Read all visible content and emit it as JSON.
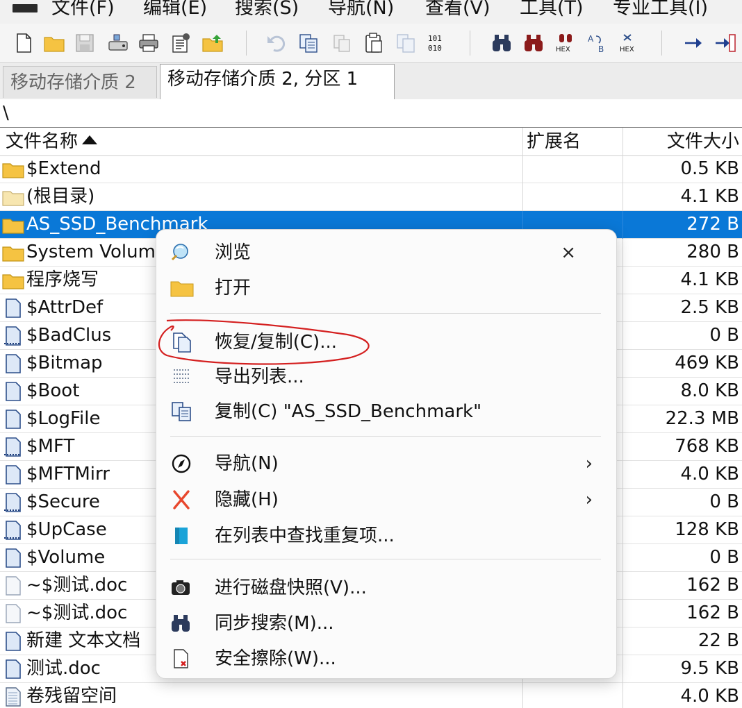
{
  "menubar": {
    "items": [
      "文件(F)",
      "编辑(E)",
      "搜索(S)",
      "导航(N)",
      "查看(V)",
      "工具(T)",
      "专业工具(I)"
    ]
  },
  "toolbar": {
    "icons": [
      "new-file-icon",
      "open-folder-icon",
      "save-icon",
      "disk-icon",
      "print-icon",
      "properties-icon",
      "export-icon",
      "undo-icon",
      "copy-icon",
      "cut-icon",
      "paste-icon",
      "paste-special-icon",
      "binary-101-010-icon",
      "find-icon",
      "find-replace-icon",
      "find-hex-icon",
      "find-text-icon",
      "replace-hex-icon",
      "goto-offset-icon",
      "goto-sector-icon"
    ],
    "labels": {
      "binary": "101\n010",
      "hex": "HEX",
      "b": "B"
    }
  },
  "tabs": [
    {
      "label": "移动存储介质 2",
      "active": false
    },
    {
      "label": "移动存储介质 2, 分区 1",
      "active": true
    }
  ],
  "path": "\\",
  "columns": {
    "name": "文件名称",
    "ext": "扩展名",
    "size": "文件大小"
  },
  "files": [
    {
      "name": "$Extend",
      "size": "0.5 KB",
      "type": "folder",
      "selected": false
    },
    {
      "name": "(根目录)",
      "size": "4.1 KB",
      "type": "folder-open",
      "selected": false
    },
    {
      "name": "AS_SSD_Benchmark",
      "size": "272 B",
      "type": "folder",
      "selected": true
    },
    {
      "name": "System Volume Information",
      "size": "280 B",
      "type": "folder",
      "selected": false
    },
    {
      "name": "程序烧写",
      "size": "4.1 KB",
      "type": "folder",
      "selected": false
    },
    {
      "name": "$AttrDef",
      "size": "2.5 KB",
      "type": "file",
      "selected": false
    },
    {
      "name": "$BadClus",
      "size": "0 B",
      "type": "file-sys",
      "selected": false
    },
    {
      "name": "$Bitmap",
      "size": "469 KB",
      "type": "file",
      "selected": false
    },
    {
      "name": "$Boot",
      "size": "8.0 KB",
      "type": "file",
      "selected": false
    },
    {
      "name": "$LogFile",
      "size": "22.3 MB",
      "type": "file",
      "selected": false
    },
    {
      "name": "$MFT",
      "size": "768 KB",
      "type": "file-sys",
      "selected": false
    },
    {
      "name": "$MFTMirr",
      "size": "4.0 KB",
      "type": "file",
      "selected": false
    },
    {
      "name": "$Secure",
      "size": "0 B",
      "type": "file-sys",
      "selected": false
    },
    {
      "name": "$UpCase",
      "size": "128 KB",
      "type": "file-sys",
      "selected": false
    },
    {
      "name": "$Volume",
      "size": "0 B",
      "type": "file",
      "selected": false
    },
    {
      "name": "~$测试.doc",
      "size": "162 B",
      "type": "file-light",
      "selected": false
    },
    {
      "name": "~$测试.doc",
      "size": "162 B",
      "type": "file-light",
      "selected": false
    },
    {
      "name": "新建 文本文档",
      "size": "22 B",
      "type": "file",
      "selected": false
    },
    {
      "name": "测试.doc",
      "size": "9.5 KB",
      "type": "file",
      "selected": false
    },
    {
      "name": "卷残留空间",
      "size": "4.0 KB",
      "type": "file-lines",
      "selected": false
    }
  ],
  "context_menu": {
    "close_glyph": "×",
    "items": [
      {
        "label": "浏览",
        "icon": "browse-icon"
      },
      {
        "label": "打开",
        "icon": "folder-icon"
      },
      {
        "label": "恢复/复制(C)...",
        "icon": "recover-copy-icon"
      },
      {
        "label": "导出列表...",
        "icon": "export-list-icon"
      },
      {
        "label": "复制(C) \"AS_SSD_Benchmark\"",
        "icon": "copy-icon"
      },
      {
        "label": "导航(N)",
        "icon": "compass-icon",
        "submenu": "›"
      },
      {
        "label": "隐藏(H)",
        "icon": "hide-x-icon",
        "submenu": "›"
      },
      {
        "label": "在列表中查找重复项...",
        "icon": "find-duplicates-icon"
      },
      {
        "label": "进行磁盘快照(V)...",
        "icon": "snapshot-icon"
      },
      {
        "label": "同步搜索(M)...",
        "icon": "sync-search-icon"
      },
      {
        "label": "安全擦除(W)...",
        "icon": "secure-erase-icon"
      }
    ]
  },
  "colors": {
    "selection": "#0a78d7",
    "folder": "#f5c342",
    "annotation": "#d42020"
  }
}
